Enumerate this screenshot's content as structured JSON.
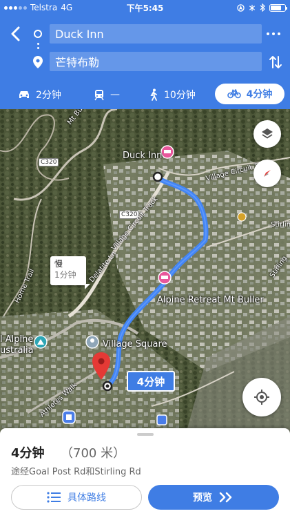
{
  "status": {
    "carrier": "Telstra",
    "network": "4G",
    "time": "下午5:45"
  },
  "header": {
    "origin": "Duck Inn",
    "destination": "芒特布勒"
  },
  "modes": {
    "car": "2分钟",
    "transit": "—",
    "walk": "10分钟",
    "bike": "4分钟",
    "selected": "bike"
  },
  "map": {
    "labels": {
      "mt_buller_rd": "Mt Buller Rd",
      "c320_a": "C320",
      "c320_b": "C320",
      "duck_inn": "Duck Inn",
      "village_circuit_track": "Village Circuit Track",
      "village_circuit_right": "Village Circuit Tr",
      "stirling": "Stirlin",
      "stirling2": "Stirling",
      "delatite": "Delatite Ln",
      "home_trail": "Home Trail",
      "alpine_retreat": "Alpine Retreat Mt Buller",
      "alpine_australia_1": "l Alpine",
      "alpine_australia_2": "ustralia",
      "village_square": "Village Square",
      "athletes_walk": "Athletes Walk"
    },
    "slow_callout": {
      "title": "慢",
      "duration": "1分钟"
    },
    "route_callout": "4分钟",
    "colors": {
      "route": "#4285f4",
      "pin": "#e53935",
      "accent": "#3f7de4"
    }
  },
  "summary": {
    "duration": "4分钟",
    "distance": "（700 米）",
    "via": "途经Goal Post Rd和Stirling Rd",
    "steps_label": "具体路线",
    "preview_label": "预览"
  }
}
